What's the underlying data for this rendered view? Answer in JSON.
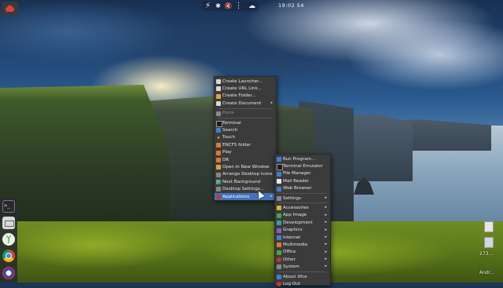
{
  "panel": {
    "clock": "19:02 54",
    "tray_icons": [
      "bolt-icon",
      "bluetooth-icon",
      "volume-muted-icon",
      "network-icon",
      "weather-icon"
    ],
    "tray_glyphs": [
      "⚡",
      "✱",
      "🔇",
      "⋮",
      "☁"
    ]
  },
  "desktop_menu": {
    "items": [
      {
        "label": "Create Launcher...",
        "icon": "launcher-icon"
      },
      {
        "label": "Create URL Link...",
        "icon": "url-link-icon"
      },
      {
        "label": "Create Folder...",
        "icon": "folder-icon"
      },
      {
        "label": "Create Document",
        "icon": "document-icon",
        "submenu": true
      },
      {
        "label": "Paste",
        "icon": "paste-icon",
        "disabled": true
      },
      {
        "label": "Terminal",
        "icon": "terminal-icon"
      },
      {
        "label": "Search",
        "icon": "search-icon"
      },
      {
        "label": "Touch",
        "icon": "star-icon"
      },
      {
        "label": "ENCFS folder",
        "icon": "encfs-icon"
      },
      {
        "label": "Play",
        "icon": "play-icon"
      },
      {
        "label": "DR",
        "icon": "dr-icon"
      },
      {
        "label": "Open in New Window",
        "icon": "window-icon"
      },
      {
        "label": "Arrange Desktop Icons",
        "icon": "arrange-icon"
      },
      {
        "label": "Next Background",
        "icon": "next-background-icon"
      },
      {
        "label": "Desktop Settings...",
        "icon": "settings-icon"
      },
      {
        "label": "Applications",
        "icon": "applications-icon",
        "submenu": true,
        "active": true
      }
    ]
  },
  "applications_menu": {
    "items": [
      {
        "label": "Run Program...",
        "icon": "run-icon"
      },
      {
        "label": "Terminal Emulator",
        "icon": "terminal-icon"
      },
      {
        "label": "File Manager",
        "icon": "file-manager-icon"
      },
      {
        "label": "Mail Reader",
        "icon": "mail-icon"
      },
      {
        "label": "Web Browser",
        "icon": "web-browser-icon"
      },
      {
        "label": "Settings",
        "icon": "settings-icon",
        "submenu": true
      },
      {
        "label": "Accessories",
        "icon": "accessories-icon",
        "submenu": true
      },
      {
        "label": "App Image",
        "icon": "app-image-icon",
        "submenu": true
      },
      {
        "label": "Development",
        "icon": "development-icon",
        "submenu": true
      },
      {
        "label": "Graphics",
        "icon": "graphics-icon",
        "submenu": true
      },
      {
        "label": "Internet",
        "icon": "internet-icon",
        "submenu": true
      },
      {
        "label": "Multimedia",
        "icon": "multimedia-icon",
        "submenu": true
      },
      {
        "label": "Office",
        "icon": "office-icon",
        "submenu": true
      },
      {
        "label": "Other",
        "icon": "other-icon",
        "submenu": true
      },
      {
        "label": "System",
        "icon": "system-icon",
        "submenu": true
      },
      {
        "label": "About Xfce",
        "icon": "about-icon"
      },
      {
        "label": "Log Out",
        "icon": "logout-icon"
      }
    ]
  },
  "dock": {
    "terminal_glyph": ">_"
  },
  "desktop_labels": {
    "count": "273...",
    "user": "Andr..."
  }
}
